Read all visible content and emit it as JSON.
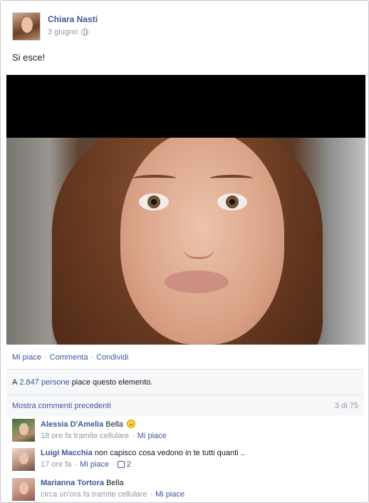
{
  "post": {
    "author": "Chiara Nasti",
    "date": "3 giugno",
    "privacy_icon": "globe-icon",
    "text": "Si esce!"
  },
  "actions": {
    "like": "Mi piace",
    "comment": "Commenta",
    "share": "Condividi",
    "separator": "·"
  },
  "likes": {
    "prefix": "A",
    "count_link": "2.847 persone",
    "suffix": "piace questo elemento."
  },
  "comments_header": {
    "more_link": "Mostra commenti precedenti",
    "counter": "3 di 75"
  },
  "comments": [
    {
      "name": "Alessia D'Amelia",
      "text": "Bella",
      "emoji": "smile-icon",
      "time": "18 ore fa tramite cellulare",
      "like": "Mi piace"
    },
    {
      "name": "Luigi Macchia",
      "text": "non capisco cosa vedono in te tutti quanti ..",
      "time": "17 ore fa",
      "like": "Mi piace",
      "likes_count": "2"
    },
    {
      "name": "Marianna Tortora",
      "text": "Bella",
      "time": "circa un'ora fa tramite cellulare",
      "like": "Mi piace"
    }
  ],
  "colors": {
    "link": "#3b5998",
    "meta": "#9197a3",
    "ufi_background": "#f6f7f8"
  }
}
